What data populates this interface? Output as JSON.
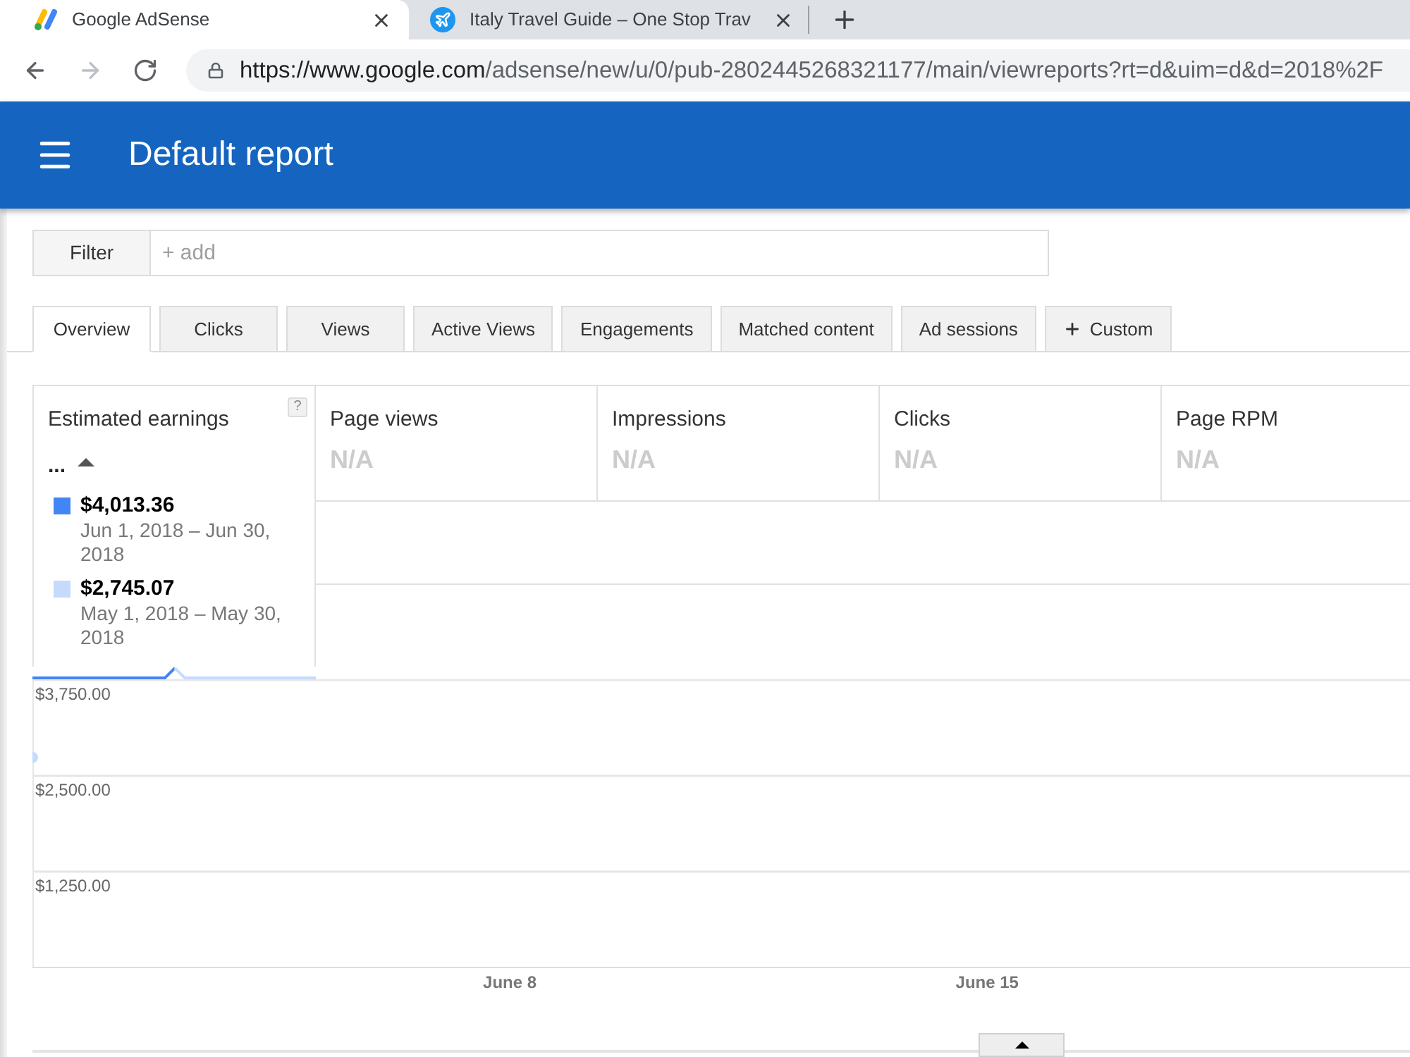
{
  "browser": {
    "tabs": [
      {
        "title": "Google AdSense",
        "selected": true,
        "kind": "bars"
      },
      {
        "title": "Italy Travel Guide – One Stop Trav",
        "selected": false,
        "kind": "plane"
      }
    ],
    "navigation": [
      {
        "kind": "back",
        "disabled": false
      },
      {
        "kind": "forward",
        "disabled": true
      },
      {
        "kind": "reload",
        "disabled": false
      }
    ],
    "address": {
      "host": "https://www.google.com",
      "path": "/adsense/new/u/0/pub-2802445268321177/main/viewreports?rt=d&uim=d&d=2018%2F"
    }
  },
  "header": {
    "title": "Default report"
  },
  "filter": {
    "label": "Filter",
    "placeholder": "+ add"
  },
  "report_tabs": [
    {
      "label": "Overview",
      "selected": true,
      "kind": "tab"
    },
    {
      "label": "Clicks",
      "selected": false,
      "kind": "tab"
    },
    {
      "label": "Views",
      "selected": false,
      "kind": "tab"
    },
    {
      "label": "Active Views",
      "selected": false,
      "kind": "tab"
    },
    {
      "label": "Engagements",
      "selected": false,
      "kind": "tab"
    },
    {
      "label": "Matched content",
      "selected": false,
      "kind": "tab"
    },
    {
      "label": "Ad sessions",
      "selected": false,
      "kind": "tab"
    },
    {
      "label": "Custom",
      "selected": false,
      "kind": "add"
    }
  ],
  "summary_card": {
    "title": "Estimated earnings",
    "help": "?",
    "value": "...",
    "selected": true,
    "legend": [
      {
        "color": "#4285f4",
        "amount": "$4,013.36",
        "range": "Jun 1, 2018 – Jun 30, 2018"
      },
      {
        "color": "#c6dafc",
        "amount": "$2,745.07",
        "range": "May 1, 2018 – May 30, 2018"
      }
    ]
  },
  "metric_cards": [
    {
      "title": "Page views",
      "value": "N/A",
      "selected": false
    },
    {
      "title": "Impressions",
      "value": "N/A",
      "selected": false
    },
    {
      "title": "Clicks",
      "value": "N/A",
      "selected": false
    },
    {
      "title": "Page RPM",
      "value": "N/A",
      "selected": false
    }
  ],
  "chart": {
    "chart_data": {
      "type": "line",
      "categories": [
        null,
        null,
        null,
        null,
        null,
        null,
        null,
        "June 8",
        null,
        null,
        null,
        null,
        null,
        null,
        "June 15",
        null,
        null,
        null,
        null,
        null,
        null
      ],
      "ylim": [
        0,
        3750
      ],
      "yticks": [
        {
          "value": 1250,
          "label": "$1,250.00"
        },
        {
          "value": 2500,
          "label": "$2,500.00"
        },
        {
          "value": 3750,
          "label": "$3,750.00"
        }
      ],
      "series": [
        {
          "color": "#c6dafc",
          "marker": "circle",
          "values": [
            2740,
            null,
            null,
            null,
            null,
            null,
            null,
            null,
            null,
            null,
            null,
            null,
            null,
            null,
            null,
            null,
            null,
            null,
            null,
            null,
            null
          ]
        }
      ]
    }
  }
}
